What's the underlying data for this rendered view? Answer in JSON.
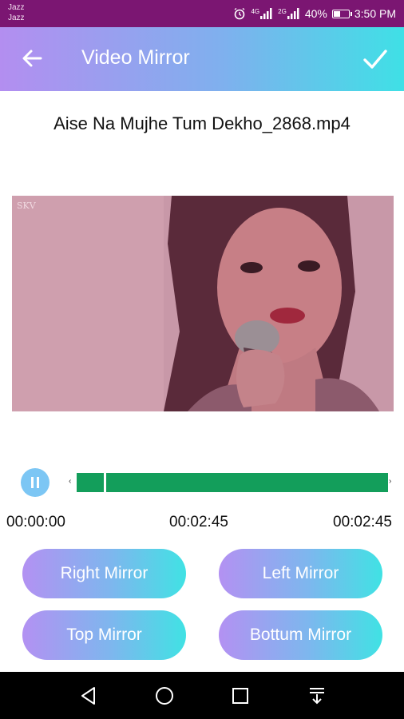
{
  "status_bar": {
    "carrier_1": "Jazz",
    "carrier_2": "Jazz",
    "network_1": "4G",
    "network_2": "2G",
    "battery_percent": "40%",
    "battery_level": 0.4,
    "time": "3:50 PM"
  },
  "app_bar": {
    "title": "Video Mirror",
    "back_icon": "arrow-left-icon",
    "confirm_icon": "check-icon"
  },
  "file_name": "Aise Na Mujhe Tum Dekho_2868.mp4",
  "video": {
    "watermark": "SKV"
  },
  "player": {
    "state_icon": "pause-icon",
    "current_time": "00:00:00",
    "selected_end": "00:02:45",
    "duration": "00:02:45",
    "seek_left_marker": "‹",
    "seek_right_marker": "›"
  },
  "mirror_buttons": {
    "right": "Right Mirror",
    "left": "Left Mirror",
    "top": "Top Mirror",
    "bottom": "Bottum Mirror"
  },
  "colors": {
    "status_bar": "#7b1672",
    "gradient_start": "#b38ef0",
    "gradient_end": "#3fe0e6",
    "seek_track": "#139e5b",
    "pause_button": "#7cc6f4"
  },
  "nav_bar": {
    "icons": [
      "back-triangle-icon",
      "home-circle-icon",
      "recents-square-icon",
      "notification-pull-icon"
    ]
  }
}
